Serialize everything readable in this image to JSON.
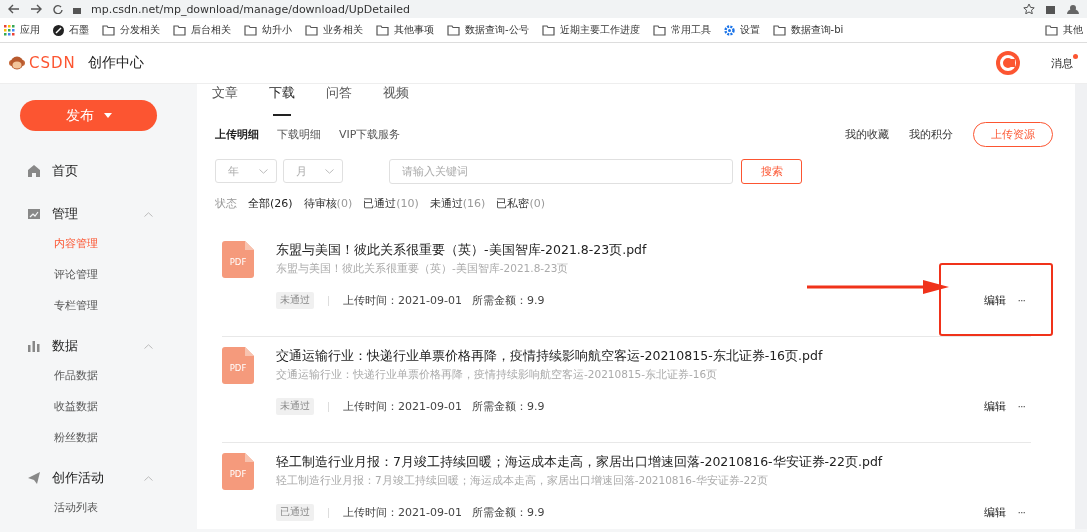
{
  "browser": {
    "url": "mp.csdn.net/mp_download/manage/download/UpDetailed",
    "bookmarks": [
      {
        "kind": "apps",
        "label": "应用"
      },
      {
        "kind": "site",
        "label": "石墨"
      },
      {
        "kind": "folder",
        "label": "分发相关"
      },
      {
        "kind": "folder",
        "label": "后台相关"
      },
      {
        "kind": "folder",
        "label": "幼升小"
      },
      {
        "kind": "folder",
        "label": "业务相关"
      },
      {
        "kind": "folder",
        "label": "其他事项"
      },
      {
        "kind": "folder",
        "label": "数据查询-公号"
      },
      {
        "kind": "folder",
        "label": "近期主要工作进度"
      },
      {
        "kind": "folder",
        "label": "常用工具"
      },
      {
        "kind": "gear",
        "label": "设置"
      },
      {
        "kind": "folder",
        "label": "数据查询-bi"
      }
    ],
    "other_bookmarks": "其他"
  },
  "header": {
    "logo_text": "CSDN",
    "title": "创作中心",
    "messages": "消息",
    "has_unread": true
  },
  "sidebar": {
    "publish": "发布",
    "groups": [
      {
        "kind": "home",
        "label": "首页"
      },
      {
        "kind": "manage",
        "label": "管理",
        "expanded": true,
        "children": [
          {
            "label": "内容管理",
            "selected": true
          },
          {
            "label": "评论管理",
            "selected": false
          },
          {
            "label": "专栏管理",
            "selected": false
          }
        ]
      },
      {
        "kind": "data",
        "label": "数据",
        "expanded": true,
        "children": [
          {
            "label": "作品数据",
            "selected": false
          },
          {
            "label": "收益数据",
            "selected": false
          },
          {
            "label": "粉丝数据",
            "selected": false
          }
        ]
      },
      {
        "kind": "activity",
        "label": "创作活动",
        "expanded": true,
        "children": [
          {
            "label": "活动列表",
            "selected": false
          }
        ]
      }
    ]
  },
  "tabs": [
    {
      "label": "文章",
      "selected": false
    },
    {
      "label": "下载",
      "selected": true
    },
    {
      "label": "问答",
      "selected": false
    },
    {
      "label": "视频",
      "selected": false
    }
  ],
  "subtabs": [
    {
      "label": "上传明细",
      "selected": true
    },
    {
      "label": "下载明细",
      "selected": false
    },
    {
      "label": "VIP下载服务",
      "selected": false
    }
  ],
  "links": [
    "我的收藏",
    "我的积分"
  ],
  "upload_button": "上传资源",
  "filters": {
    "year": "年",
    "month": "月",
    "search": {
      "placeholder": "请输入关键词"
    },
    "search_button": "搜索"
  },
  "status": {
    "label": "状态",
    "options": [
      {
        "name": "全部",
        "count": "(26)",
        "selected": true
      },
      {
        "name": "待审核",
        "count": "(0)",
        "selected": false
      },
      {
        "name": "已通过",
        "count": "(10)",
        "selected": false
      },
      {
        "name": "未通过",
        "count": "(16)",
        "selected": false
      },
      {
        "name": "已私密",
        "count": "(0)",
        "selected": false
      }
    ]
  },
  "items": [
    {
      "file_type": "PDF",
      "title": "东盟与美国！彼此关系很重要（英）-美国智库-2021.8-23页.pdf",
      "description": "东盟与美国！彼此关系很重要（英）-美国智库-2021.8-23页",
      "status": "未通过",
      "upload_time": "上传时间：2021-09-01",
      "price": "所需金额：9.9",
      "edit": "编辑",
      "more": "···",
      "highlighted": true
    },
    {
      "file_type": "PDF",
      "title": "交通运输行业：快递行业单票价格再降，疫情持续影响航空客运-20210815-东北证券-16页.pdf",
      "description": "交通运输行业：快递行业单票价格再降，疫情持续影响航空客运-20210815-东北证券-16页",
      "status": "未通过",
      "upload_time": "上传时间：2021-09-01",
      "price": "所需金额：9.9",
      "edit": "编辑",
      "more": "···",
      "highlighted": false
    },
    {
      "file_type": "PDF",
      "title": "轻工制造行业月报：7月竣工持续回暖；海运成本走高，家居出口增速回落-20210816-华安证券-22页.pdf",
      "description": "轻工制造行业月报：7月竣工持续回暖；海运成本走高，家居出口增速回落-20210816-华安证券-22页",
      "status": "已通过",
      "upload_time": "上传时间：2021-09-01",
      "price": "所需金额：9.9",
      "edit": "编辑",
      "more": "···",
      "highlighted": false
    }
  ]
}
